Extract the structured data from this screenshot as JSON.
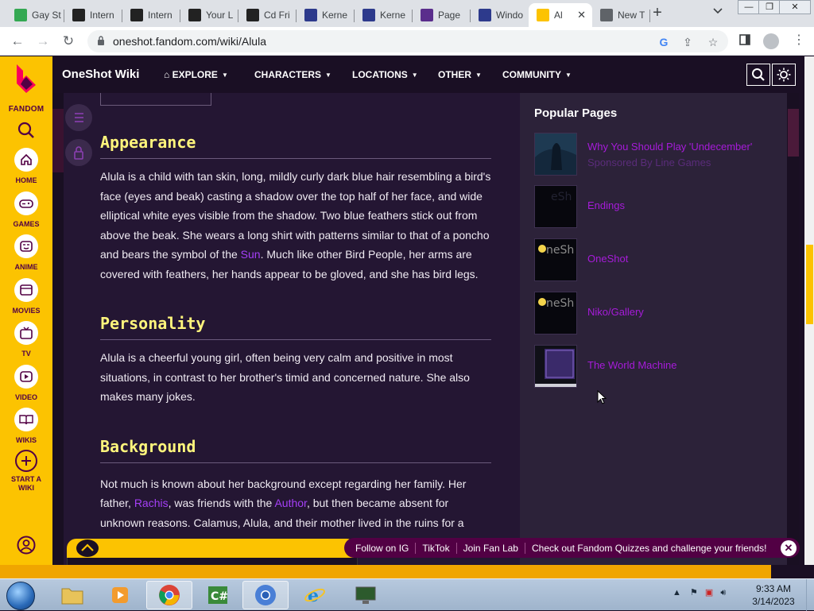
{
  "browser": {
    "tabs": [
      {
        "title": "Gay St",
        "icon": "maps-icon",
        "color": "#34a853"
      },
      {
        "title": "Intern",
        "icon": "archive-icon",
        "color": "#222222"
      },
      {
        "title": "Intern",
        "icon": "archive-icon",
        "color": "#222222"
      },
      {
        "title": "Your L",
        "icon": "archive-icon",
        "color": "#222222"
      },
      {
        "title": "Cd Fri",
        "icon": "archive-icon",
        "color": "#222222"
      },
      {
        "title": "Kerne",
        "icon": "k-icon",
        "color": "#2d3a8c"
      },
      {
        "title": "Kerne",
        "icon": "k-icon",
        "color": "#2d3a8c"
      },
      {
        "title": "Page",
        "icon": "pr-icon",
        "color": "#5a2d8c"
      },
      {
        "title": "Windo",
        "icon": "k-icon",
        "color": "#2d3a8c"
      },
      {
        "title": "Al",
        "icon": "fandom-sun-icon",
        "color": "#fcc301"
      },
      {
        "title": "New T",
        "icon": "chrome-icon",
        "color": "#5f6368"
      }
    ],
    "url": "oneshot.fandom.com/wiki/Alula",
    "new_tab_label": "+"
  },
  "rail": {
    "brand": "FANDOM",
    "items": [
      {
        "label": "HOME",
        "icon": "home-icon"
      },
      {
        "label": "GAMES",
        "icon": "gamepad-icon"
      },
      {
        "label": "ANIME",
        "icon": "anime-icon"
      },
      {
        "label": "MOVIES",
        "icon": "movies-icon"
      },
      {
        "label": "TV",
        "icon": "tv-icon"
      },
      {
        "label": "VIDEO",
        "icon": "video-icon"
      },
      {
        "label": "WIKIS",
        "icon": "wikis-icon"
      },
      {
        "label": "START A WIKI",
        "icon": "plus-icon"
      }
    ]
  },
  "wikinav": {
    "title": "OneShot Wiki",
    "explore": "EXPLORE",
    "characters": "CHARACTERS",
    "locations": "LOCATIONS",
    "other": "OTHER",
    "community": "COMMUNITY"
  },
  "article": {
    "appearance": {
      "heading": "Appearance",
      "text_before": "Alula is a child with tan skin, long, mildly curly dark blue hair resembling a bird's face (eyes and beak) casting a shadow over the top half of her face, and wide elliptical white eyes visible from the shadow. Two blue feathers stick out from above the beak. She wears a long shirt with patterns similar to that of a poncho and bears the symbol of the ",
      "link_sun": "Sun",
      "text_after": ". Much like other Bird People, her arms are covered with feathers, her hands appear to be gloved, and she has bird legs."
    },
    "personality": {
      "heading": "Personality",
      "text": "Alula is a cheerful young girl, often being very calm and positive in most situations, in contrast to her brother's timid and concerned nature. She also makes many jokes."
    },
    "background": {
      "heading": "Background",
      "text_1": "Not much is known about her background except regarding her family. Her father, ",
      "link_rachis": "Rachis",
      "text_2": ", was friends with the ",
      "link_author": "Author",
      "text_3": ", but then became absent for unknown reasons. Calamus, Alula, and their mother lived in the ruins for a"
    }
  },
  "popular": {
    "title": "Popular Pages",
    "items": [
      {
        "label": "Why You Should Play 'Undecember'",
        "sub": "Sponsored By Line Games"
      },
      {
        "label": "Endings"
      },
      {
        "label": "OneShot"
      },
      {
        "label": "Niko/Gallery"
      },
      {
        "label": "The World Machine"
      }
    ]
  },
  "fanbar": {
    "follow_ig": "Follow on IG",
    "tiktok": "TikTok",
    "fan_lab": "Join Fan Lab",
    "quizzes": "Check out Fandom Quizzes and challenge your friends!"
  },
  "taskbar": {
    "time": "9:33 AM",
    "date": "3/14/2023"
  },
  "colors": {
    "fandom_yellow": "#fcc301",
    "fandom_purple": "#520044",
    "heading_yellow": "#fff57c",
    "link_purple": "#a53ff7"
  }
}
